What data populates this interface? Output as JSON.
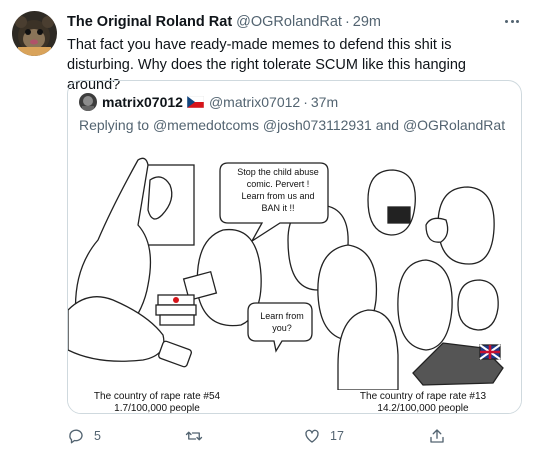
{
  "tweet": {
    "display_name": "The Original Roland Rat",
    "handle": "@OGRolandRat",
    "separator": "·",
    "time": "29m",
    "text": "That fact you have ready-made memes to defend this shit is disturbing. Why does the right tolerate SCUM like this hanging around?"
  },
  "quote": {
    "display_name": "matrix07012",
    "flag_icon": "czech-flag-icon",
    "handle": "@matrix07012",
    "separator": "·",
    "time": "37m",
    "replying_prefix": "Replying to",
    "mentions": [
      "@memedotcoms",
      "@josh073112931"
    ],
    "and_word": "and",
    "last_mention": "@OGRolandRat",
    "comic": {
      "bubble_1": [
        "Stop the child abuse",
        "comic. Pervert !",
        "Learn from us and",
        "BAN it !!"
      ],
      "bubble_2": [
        "Learn from",
        "you?"
      ],
      "caption_left_1": "The country of rape rate #54",
      "caption_left_2": "1.7/100,000 people",
      "caption_right_1": "The country of rape rate #13",
      "caption_right_2": "14.2/100,000 people"
    }
  },
  "actions": {
    "reply_count": "5",
    "retweet_count": "",
    "like_count": "17",
    "share_count": ""
  },
  "colors": {
    "text": "#0f1419",
    "secondary": "#536471",
    "border": "#cfd9de"
  }
}
